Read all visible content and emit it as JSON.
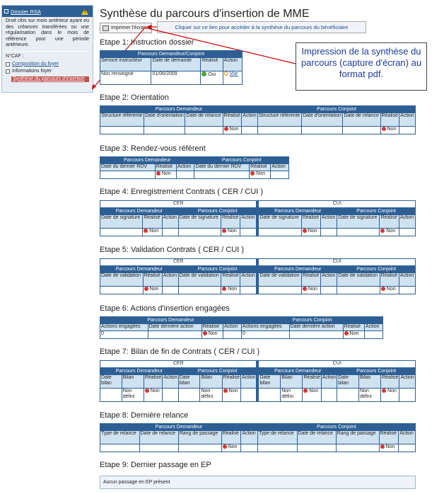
{
  "sidebar": {
    "title": "Dossier RSA",
    "notice": "Droit clos sur mois antérieur ayant eu des créances transférées ou une régularisation dans le mois de référence pour une période antérieure.",
    "caf_label": "N°CAF :",
    "links": [
      "Composition du foyer",
      "Informations foyer",
      "Synthèse du parcours d'insertion"
    ]
  },
  "page": {
    "title": "Synthèse du parcours d'insertion de MME",
    "print_label": "Imprimer l'écran",
    "callout_link": "Cliquer sur ce lien pour accéder à la synthèse du parcours du bénéficiaire",
    "callout_note": "Impression de la synthèse du parcours (capture d'écran) au format pdf."
  },
  "steps": {
    "s1": {
      "title": "Etape 1: Instruction dossier",
      "group": "Parcours Demandeur/Conjoint",
      "cols": [
        "Service instructeur",
        "Date de demande",
        "Réalisé",
        "Action"
      ],
      "vals": [
        "Non renseigné",
        "01/06/2009",
        "Oui",
        "Voir"
      ]
    },
    "s2": {
      "title": "Etape 2: Orientation",
      "g1": "Parcours Demandeur",
      "g2": "Parcours Conjoint",
      "cols": [
        "Structure référente",
        "Date d'orientation",
        "Date de relance",
        "Réalisé",
        "Action"
      ],
      "non": "Non"
    },
    "s3": {
      "title": "Etape 3: Rendez-vous référent",
      "g1": "Parcours Demandeur",
      "g2": "Parcours Conjoint",
      "cols": [
        "Date du dernier RDV",
        "Réalisé",
        "Action"
      ],
      "non": "Non"
    },
    "s4": {
      "title": "Etape 4: Enregistrement Contrats ( CER / CUI )",
      "top1": "CER",
      "top2": "CUI",
      "g1": "Parcours Demandeur",
      "g2": "Parcours Conjoint",
      "cols": [
        "Date de signature",
        "Réalisé",
        "Action"
      ],
      "non": "Non"
    },
    "s5": {
      "title": "Etape 5: Validation Contrats ( CER / CUI )",
      "top1": "CER",
      "top2": "CUI",
      "g1": "Parcours Demandeur",
      "g2": "Parcours Conjoint",
      "cols": [
        "Date de validation",
        "Réalisé",
        "Action"
      ],
      "non": "Non"
    },
    "s6": {
      "title": "Etape 6: Actions d'insertion engagées",
      "g1": "Parcours Demandeur",
      "g2": "Parcours Conjoint",
      "cols": [
        "Actions engagées",
        "Date dernière action",
        "Réalisé",
        "Action"
      ],
      "val0": "0",
      "non": "Non"
    },
    "s7": {
      "title": "Etape 7: Bilan de fin de Contrats ( CER / CUI )",
      "top1": "CER",
      "top2": "CUI",
      "g1": "Parcours Demandeur",
      "g2": "Parcours Conjoint",
      "cols": [
        "Date bilan",
        "Bilan",
        "Réalisé",
        "Action"
      ],
      "nondef": "Non défini",
      "non": "Non"
    },
    "s8": {
      "title": "Etape 8: Dernière relance",
      "g1": "Parcours Demandeur",
      "g2": "Parcours Conjoint",
      "cols": [
        "Type de relance",
        "Date de relance",
        "Rang de passage",
        "Réalisé",
        "Action"
      ],
      "non": "Non"
    },
    "s9": {
      "title": "Etape 9: Dernier passage en EP",
      "msg": "Aucun passage en EP présent"
    }
  },
  "colors": {
    "header": "#2d5f95",
    "subheader": "#cfe2f0",
    "not_done": "#d9362c",
    "done": "#4aa832"
  }
}
